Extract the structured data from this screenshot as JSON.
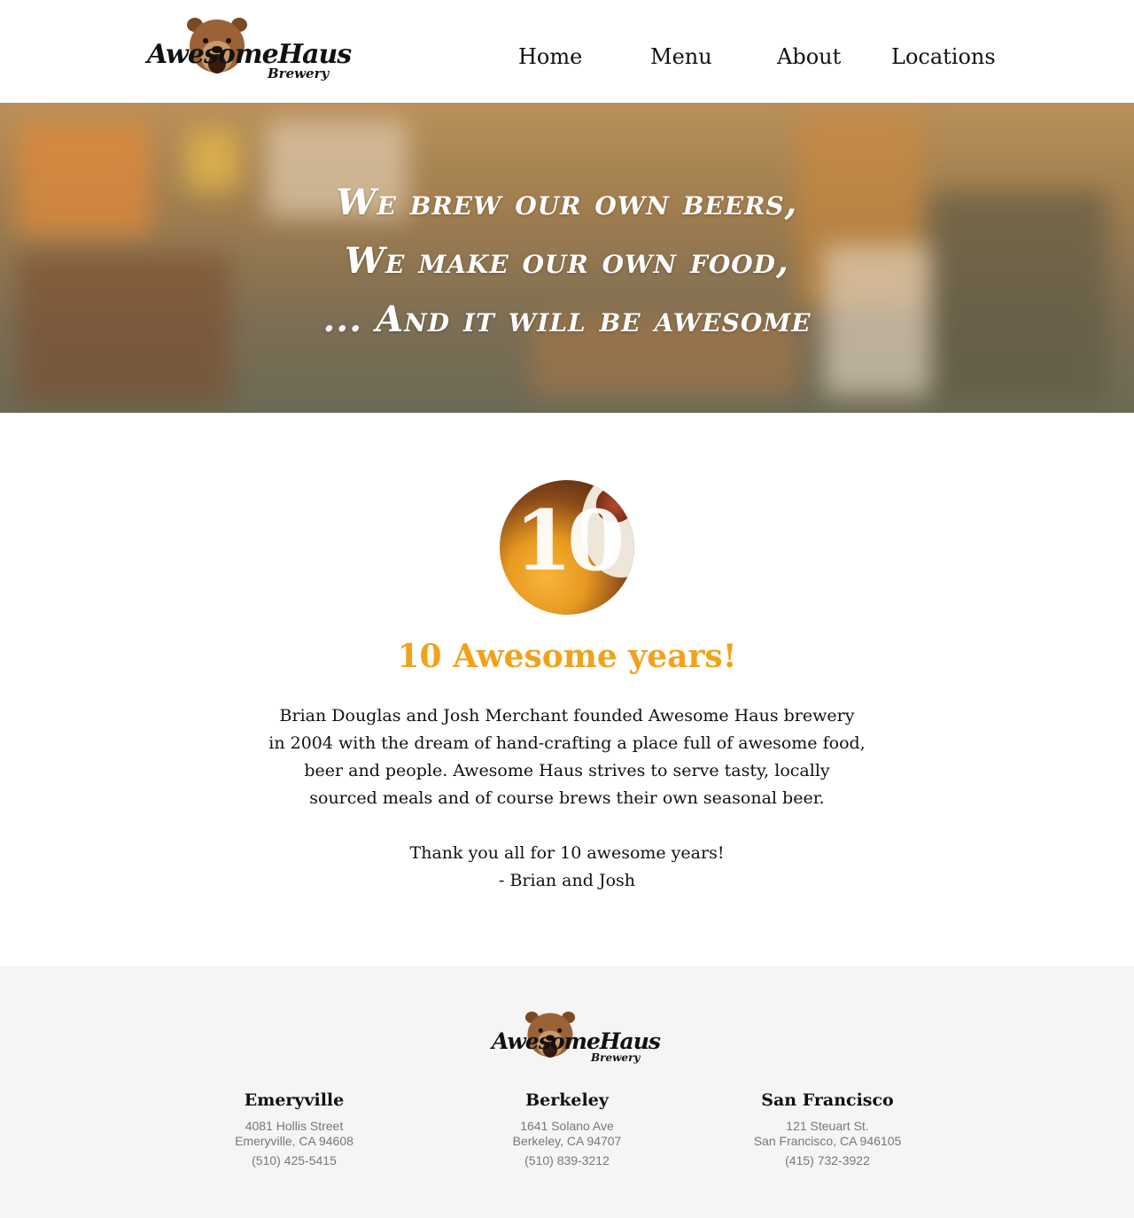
{
  "brand": {
    "logo_wordmark": "AwesomeHaus",
    "logo_sub": "Brewery"
  },
  "nav": {
    "items": [
      {
        "label": "Home"
      },
      {
        "label": "Menu"
      },
      {
        "label": "About"
      },
      {
        "label": "Locations"
      }
    ]
  },
  "hero": {
    "lines": [
      "We brew our own beers,",
      "We make our own food,",
      "... And it will be awesome"
    ]
  },
  "badge": {
    "number": "10"
  },
  "about": {
    "title": "10 Awesome years!",
    "paragraph_lines": [
      "Brian Douglas and Josh Merchant founded Awesome Haus brewery",
      "in 2004 with the dream of hand-crafting a place full of awesome food,",
      "beer and people. Awesome Haus strives to serve tasty, locally",
      "sourced meals and of course brews their own seasonal beer."
    ],
    "thanks": "Thank you all for 10 awesome years!",
    "signature": "- Brian and Josh"
  },
  "footer": {
    "locations": [
      {
        "city": "Emeryville",
        "street": "4081 Hollis Street",
        "citystate": "Emeryville, CA 94608",
        "phone": "(510) 425-5415"
      },
      {
        "city": "Berkeley",
        "street": "1641 Solano Ave",
        "citystate": "Berkeley, CA 94707",
        "phone": "(510) 839-3212"
      },
      {
        "city": "San Francisco",
        "street": "121 Steuart St.",
        "citystate": "San Francisco, CA 946105",
        "phone": "(415) 732-3922"
      }
    ]
  },
  "colors": {
    "accent": "#f0a21a",
    "footer_bg": "#f5f5f5",
    "muted_text": "#777777"
  }
}
